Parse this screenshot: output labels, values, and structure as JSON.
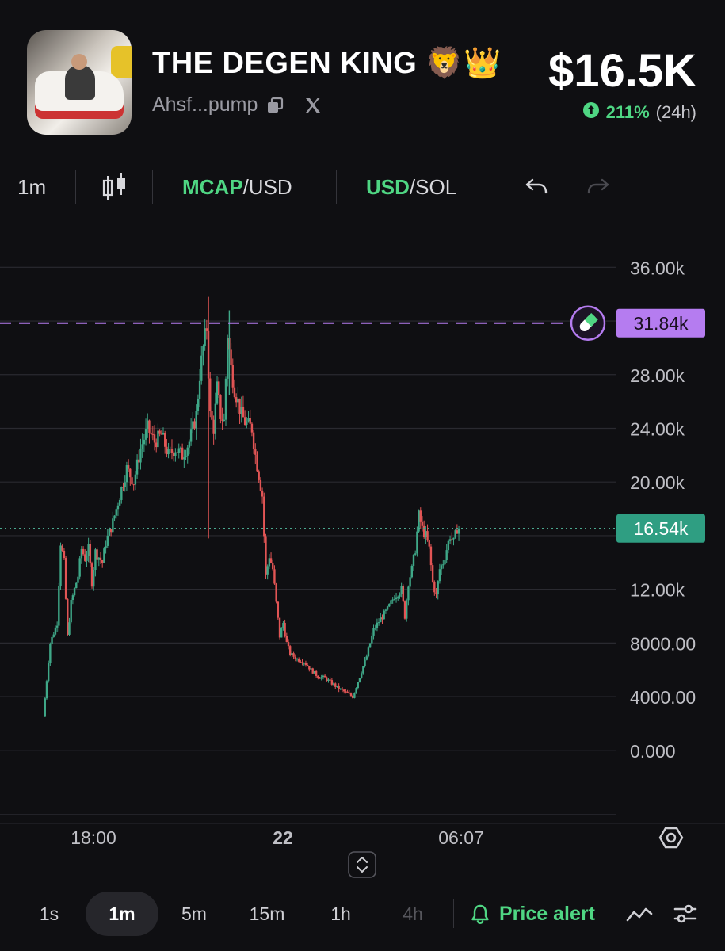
{
  "header": {
    "token_name": "THE DEGEN KING",
    "token_emojis": "🦁👑",
    "address": "Ahsf...pump",
    "price": "$16.5K",
    "change_pct": "211%",
    "change_period": "(24h)"
  },
  "toolbar": {
    "interval": "1m",
    "mcap_label": "MCAP",
    "mcap_suffix": "/USD",
    "usd_label": "USD",
    "usd_suffix": "/SOL"
  },
  "colors": {
    "up": "#4fd683",
    "down": "#f05a5a",
    "candle_up": "#3fa888",
    "candle_down": "#e25555",
    "ath_line": "#b57cf0",
    "current_label": "#2f9e82"
  },
  "chart_data": {
    "type": "candlestick",
    "y_ticks": [
      "36.00k",
      "28.00k",
      "24.00k",
      "20.00k",
      "12.00k",
      "8000.00",
      "4000.00",
      "0.000"
    ],
    "ylim": [
      -4500,
      38500
    ],
    "x_ticks": [
      "18:00",
      "22",
      "06:07"
    ],
    "ath_value": 31840,
    "ath_label": "31.84k",
    "current_value": 16540,
    "current_label": "16.54k",
    "series": [
      {
        "x": 0,
        "y": 2500
      },
      {
        "x": 2,
        "y": 8000
      },
      {
        "x": 4,
        "y": 9500
      },
      {
        "x": 5,
        "y": 15500
      },
      {
        "x": 6,
        "y": 14000
      },
      {
        "x": 7,
        "y": 8500
      },
      {
        "x": 8,
        "y": 11000
      },
      {
        "x": 10,
        "y": 13000
      },
      {
        "x": 11,
        "y": 15000
      },
      {
        "x": 12,
        "y": 14300
      },
      {
        "x": 13,
        "y": 15000
      },
      {
        "x": 14,
        "y": 12500
      },
      {
        "x": 15,
        "y": 14800
      },
      {
        "x": 17,
        "y": 14000
      },
      {
        "x": 18,
        "y": 15500
      },
      {
        "x": 20,
        "y": 17000
      },
      {
        "x": 22,
        "y": 19000
      },
      {
        "x": 24,
        "y": 21000
      },
      {
        "x": 26,
        "y": 20000
      },
      {
        "x": 28,
        "y": 22500
      },
      {
        "x": 30,
        "y": 24000
      },
      {
        "x": 32,
        "y": 23000
      },
      {
        "x": 34,
        "y": 23500
      },
      {
        "x": 36,
        "y": 22000
      },
      {
        "x": 38,
        "y": 22500
      },
      {
        "x": 40,
        "y": 22000
      },
      {
        "x": 42,
        "y": 23000
      },
      {
        "x": 44,
        "y": 25000
      },
      {
        "x": 45,
        "y": 28000
      },
      {
        "x": 46,
        "y": 30000
      },
      {
        "x": 47,
        "y": 31500
      },
      {
        "x": 48,
        "y": 25000
      },
      {
        "x": 49,
        "y": 24000
      },
      {
        "x": 50,
        "y": 27000
      },
      {
        "x": 51,
        "y": 25000
      },
      {
        "x": 52,
        "y": 24500
      },
      {
        "x": 53,
        "y": 31000
      },
      {
        "x": 54,
        "y": 28500
      },
      {
        "x": 55,
        "y": 27000
      },
      {
        "x": 56,
        "y": 26000
      },
      {
        "x": 57,
        "y": 25000
      },
      {
        "x": 58,
        "y": 24500
      },
      {
        "x": 60,
        "y": 24000
      },
      {
        "x": 61,
        "y": 22000
      },
      {
        "x": 62,
        "y": 20500
      },
      {
        "x": 63,
        "y": 19000
      },
      {
        "x": 64,
        "y": 13000
      },
      {
        "x": 65,
        "y": 14500
      },
      {
        "x": 66,
        "y": 13500
      },
      {
        "x": 67,
        "y": 11000
      },
      {
        "x": 68,
        "y": 8500
      },
      {
        "x": 69,
        "y": 9500
      },
      {
        "x": 70,
        "y": 8000
      },
      {
        "x": 71,
        "y": 7200
      },
      {
        "x": 73,
        "y": 6800
      },
      {
        "x": 75,
        "y": 6600
      },
      {
        "x": 77,
        "y": 6000
      },
      {
        "x": 79,
        "y": 5500
      },
      {
        "x": 81,
        "y": 5400
      },
      {
        "x": 83,
        "y": 5000
      },
      {
        "x": 85,
        "y": 4600
      },
      {
        "x": 87,
        "y": 4300
      },
      {
        "x": 89,
        "y": 4000
      },
      {
        "x": 91,
        "y": 5500
      },
      {
        "x": 93,
        "y": 7000
      },
      {
        "x": 95,
        "y": 9000
      },
      {
        "x": 97,
        "y": 9800
      },
      {
        "x": 99,
        "y": 10500
      },
      {
        "x": 101,
        "y": 11500
      },
      {
        "x": 103,
        "y": 12000
      },
      {
        "x": 104,
        "y": 10000
      },
      {
        "x": 105,
        "y": 12500
      },
      {
        "x": 106,
        "y": 13500
      },
      {
        "x": 107,
        "y": 15000
      },
      {
        "x": 108,
        "y": 17500
      },
      {
        "x": 109,
        "y": 16500
      },
      {
        "x": 110,
        "y": 16000
      },
      {
        "x": 111,
        "y": 15000
      },
      {
        "x": 112,
        "y": 12500
      },
      {
        "x": 113,
        "y": 11500
      },
      {
        "x": 114,
        "y": 13500
      },
      {
        "x": 115,
        "y": 14000
      },
      {
        "x": 116,
        "y": 15000
      },
      {
        "x": 117,
        "y": 16000
      },
      {
        "x": 118,
        "y": 15500
      },
      {
        "x": 119,
        "y": 16540
      }
    ],
    "x_range": [
      -2,
      178
    ]
  },
  "timeframes": [
    {
      "label": "1s",
      "state": "normal"
    },
    {
      "label": "1m",
      "state": "active"
    },
    {
      "label": "5m",
      "state": "normal"
    },
    {
      "label": "15m",
      "state": "normal"
    },
    {
      "label": "1h",
      "state": "normal"
    },
    {
      "label": "4h",
      "state": "disabled"
    }
  ],
  "price_alert_label": "Price alert"
}
